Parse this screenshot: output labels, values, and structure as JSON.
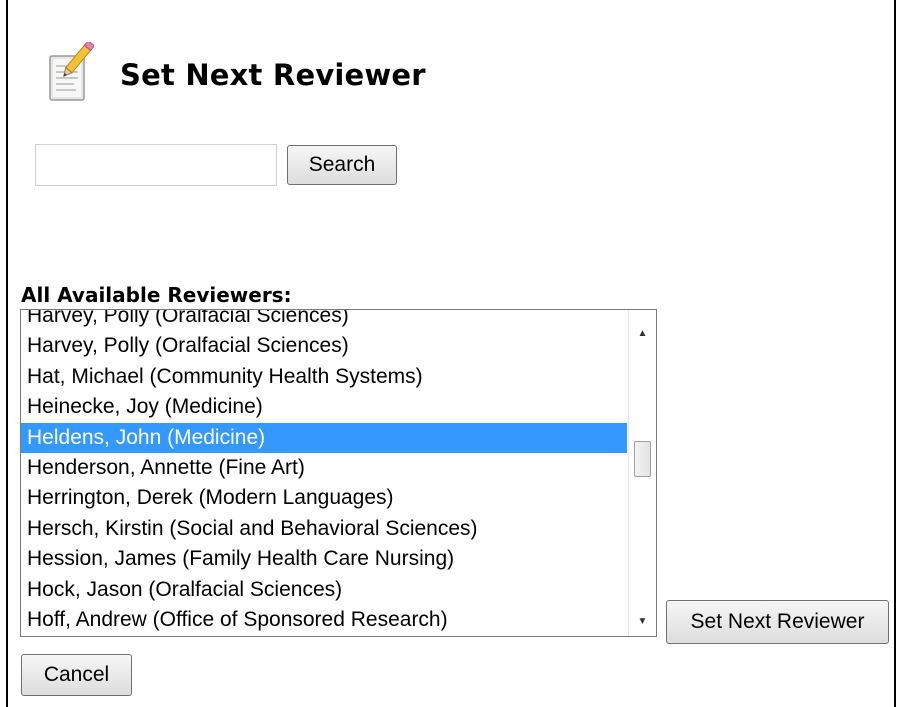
{
  "header": {
    "icon": "notepad-pencil-icon",
    "title": "Set Next Reviewer"
  },
  "search": {
    "value": "",
    "placeholder": "",
    "button_label": "Search"
  },
  "reviewers": {
    "label": "All Available Reviewers:",
    "selected_index": 4,
    "items": [
      "Harvey, Polly (Oralfacial Sciences)",
      "Harvey, Polly (Oralfacial Sciences)",
      "Hat, Michael (Community Health Systems)",
      "Heinecke, Joy (Medicine)",
      "Heldens, John (Medicine)",
      "Henderson, Annette (Fine Art)",
      "Herrington, Derek (Modern Languages)",
      "Hersch, Kirstin (Social and Behavioral Sciences)",
      "Hession, James (Family Health Care Nursing)",
      "Hock, Jason (Oralfacial Sciences)",
      "Hoff, Andrew (Office of Sponsored Research)"
    ],
    "scroll_position": 0.42
  },
  "actions": {
    "set_next_label": "Set Next Reviewer",
    "cancel_label": "Cancel"
  },
  "colors": {
    "selection": "#3399ff",
    "selection_text": "#ffffff"
  }
}
